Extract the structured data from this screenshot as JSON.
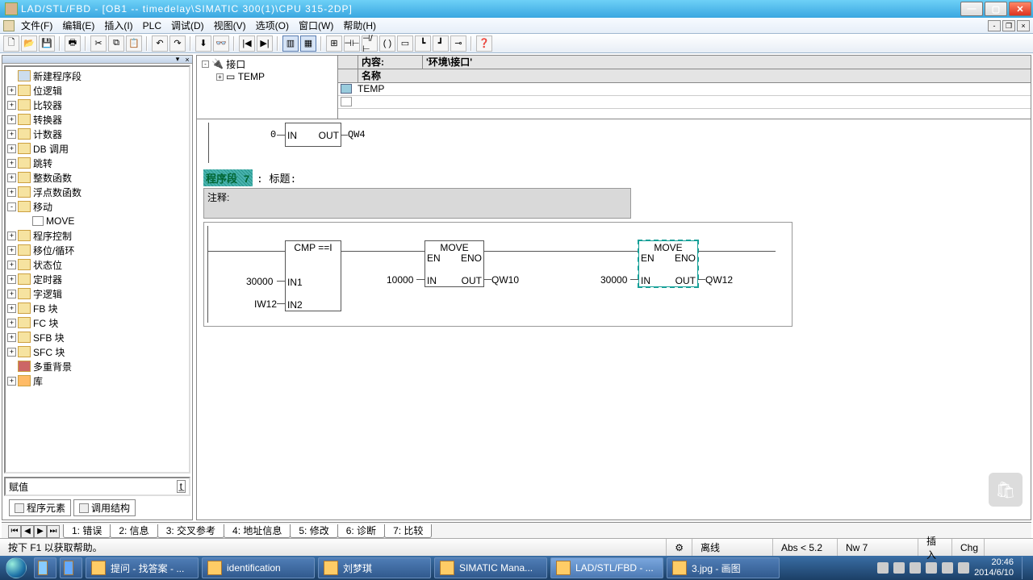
{
  "title": "LAD/STL/FBD  - [OB1 -- timedelay\\SIMATIC 300(1)\\CPU 315-2DP]",
  "menu": {
    "file": "文件(F)",
    "edit": "编辑(E)",
    "insert": "插入(I)",
    "plc": "PLC",
    "debug": "调试(D)",
    "view": "视图(V)",
    "options": "选项(O)",
    "window": "窗口(W)",
    "help": "帮助(H)"
  },
  "tree": {
    "items": [
      {
        "icon": "new",
        "label": "新建程序段",
        "lvl": 0,
        "exp": "",
        "special": true
      },
      {
        "icon": "folder",
        "label": "位逻辑",
        "lvl": 0,
        "exp": "+"
      },
      {
        "icon": "folder",
        "label": "比较器",
        "lvl": 0,
        "exp": "+"
      },
      {
        "icon": "folder",
        "label": "转换器",
        "lvl": 0,
        "exp": "+"
      },
      {
        "icon": "folder",
        "label": "计数器",
        "lvl": 0,
        "exp": "+"
      },
      {
        "icon": "folder",
        "label": "DB 调用",
        "lvl": 0,
        "exp": "+"
      },
      {
        "icon": "folder",
        "label": "跳转",
        "lvl": 0,
        "exp": "+"
      },
      {
        "icon": "folder",
        "label": "整数函数",
        "lvl": 0,
        "exp": "+"
      },
      {
        "icon": "folder",
        "label": "浮点数函数",
        "lvl": 0,
        "exp": "+"
      },
      {
        "icon": "folder",
        "label": "移动",
        "lvl": 0,
        "exp": "-"
      },
      {
        "icon": "leaf",
        "label": "MOVE",
        "lvl": 1,
        "exp": ""
      },
      {
        "icon": "folder",
        "label": "程序控制",
        "lvl": 0,
        "exp": "+"
      },
      {
        "icon": "folder",
        "label": "移位/循环",
        "lvl": 0,
        "exp": "+"
      },
      {
        "icon": "folder",
        "label": "状态位",
        "lvl": 0,
        "exp": "+"
      },
      {
        "icon": "folder",
        "label": "定时器",
        "lvl": 0,
        "exp": "+"
      },
      {
        "icon": "folder",
        "label": "字逻辑",
        "lvl": 0,
        "exp": "+"
      },
      {
        "icon": "folder",
        "label": "FB 块",
        "lvl": 0,
        "exp": "+"
      },
      {
        "icon": "folder",
        "label": "FC 块",
        "lvl": 0,
        "exp": "+"
      },
      {
        "icon": "folder",
        "label": "SFB 块",
        "lvl": 0,
        "exp": "+"
      },
      {
        "icon": "folder",
        "label": "SFC 块",
        "lvl": 0,
        "exp": "+"
      },
      {
        "icon": "multi",
        "label": "多重背景",
        "lvl": 0,
        "exp": ""
      },
      {
        "icon": "lib",
        "label": "库",
        "lvl": 0,
        "exp": "+"
      }
    ]
  },
  "assign_label": "赋值",
  "lefttabs": {
    "elements": "程序元素",
    "callstruct": "调用结构"
  },
  "interface": {
    "content_label": "内容:",
    "content_value": "'环境\\接口'",
    "name_header": "名称",
    "root": "接口",
    "temp": "TEMP",
    "row_temp": "TEMP"
  },
  "ladder": {
    "prev": {
      "in": "IN",
      "out": "OUT",
      "inval": "0",
      "outval": "QW4"
    },
    "nwlabel": "程序段 7",
    "nwtitle": ": 标题:",
    "comment": "注释:",
    "cmp": {
      "title": "CMP ==I",
      "in1": "IN1",
      "in2": "IN2",
      "in1v": "30000",
      "in2v": "IW12"
    },
    "move1": {
      "title": "MOVE",
      "en": "EN",
      "eno": "ENO",
      "in": "IN",
      "out": "OUT",
      "inv": "10000",
      "outv": "QW10"
    },
    "move2": {
      "title": "MOVE",
      "en": "EN",
      "eno": "ENO",
      "in": "IN",
      "out": "OUT",
      "inv": "30000",
      "outv": "QW12"
    }
  },
  "bottomtabs": {
    "t1": "1: 错误",
    "t2": "2: 信息",
    "t3": "3: 交叉参考",
    "t4": "4: 地址信息",
    "t5": "5: 修改",
    "t6": "6: 诊断",
    "t7": "7: 比较"
  },
  "status": {
    "help": "按下 F1 以获取帮助。",
    "offline": "离线",
    "abs": "Abs < 5.2",
    "nw": "Nw 7",
    "ins": "插入",
    "chg": "Chg"
  },
  "taskbar": {
    "items": [
      {
        "label": "提问 - 找答案 - ...",
        "kind": "ie"
      },
      {
        "label": "identification",
        "kind": "folder"
      },
      {
        "label": "刘梦琪",
        "kind": "app"
      },
      {
        "label": "SIMATIC Mana...",
        "kind": "simatic"
      },
      {
        "label": "LAD/STL/FBD  - ...",
        "kind": "lad"
      },
      {
        "label": "3.jpg - 画图",
        "kind": "paint"
      }
    ],
    "time": "20:46",
    "date": "2014/6/10"
  }
}
